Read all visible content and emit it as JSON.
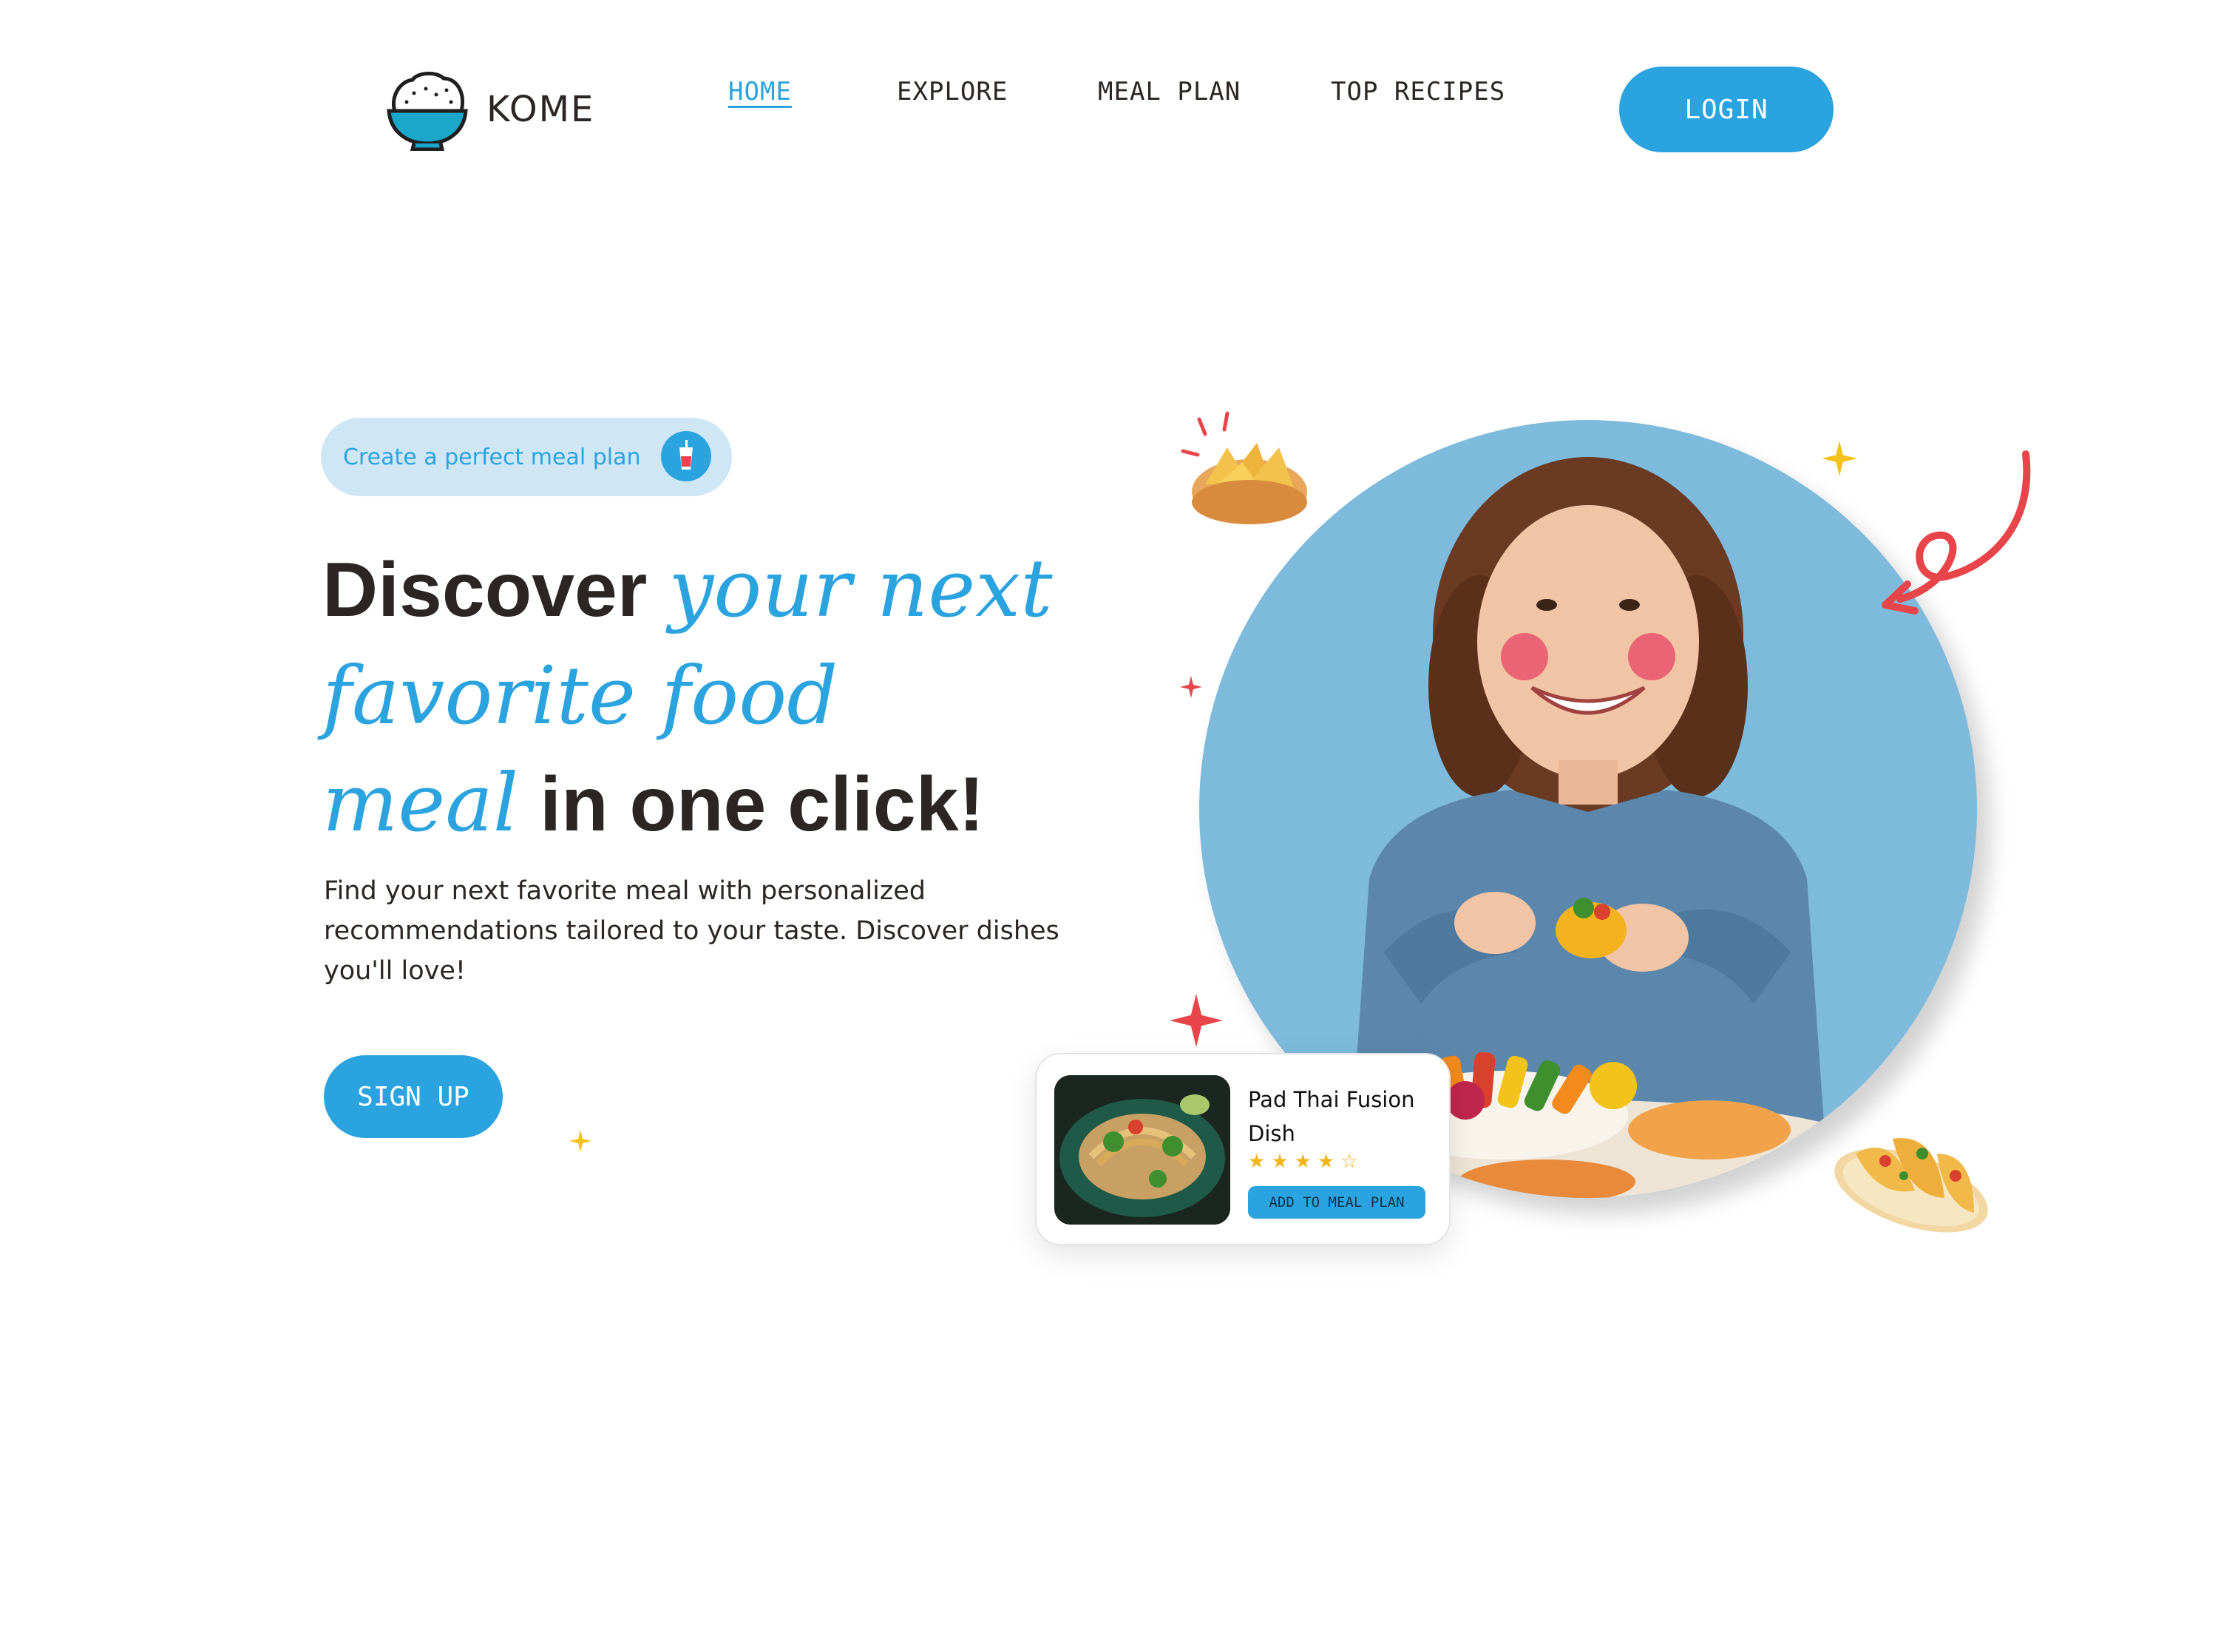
{
  "brand": {
    "name": "KOME"
  },
  "nav": {
    "items": [
      {
        "label": "HOME",
        "active": true
      },
      {
        "label": "EXPLORE"
      },
      {
        "label": "MEAL PLAN"
      },
      {
        "label": "TOP RECIPES"
      }
    ],
    "login_label": "LOGIN"
  },
  "hero": {
    "pill_label": "Create a perfect meal plan",
    "headline": {
      "part1": "Discover",
      "script1": "your next",
      "script2": "favorite food",
      "script3": "meal",
      "part2": "in one click!"
    },
    "subtext": "Find your next favorite meal with personalized recommendations tailored to your taste. Discover dishes you'll love!",
    "signup_label": "SIGN UP"
  },
  "recipe_card": {
    "title": "Pad Thai Fusion Dish",
    "rating": 4,
    "rating_max": 5,
    "button_label": "ADD TO MEAL PLAN"
  },
  "colors": {
    "accent": "#2ba3df",
    "pill_bg": "#cfe6f4",
    "circle_bg": "#7dbadc",
    "text": "#2b2523",
    "sparkle_red": "#e8454b",
    "sparkle_yellow": "#f3c21b"
  },
  "icons": {
    "logo": "rice-bowl-icon",
    "pill": "drink-cup-icon"
  }
}
